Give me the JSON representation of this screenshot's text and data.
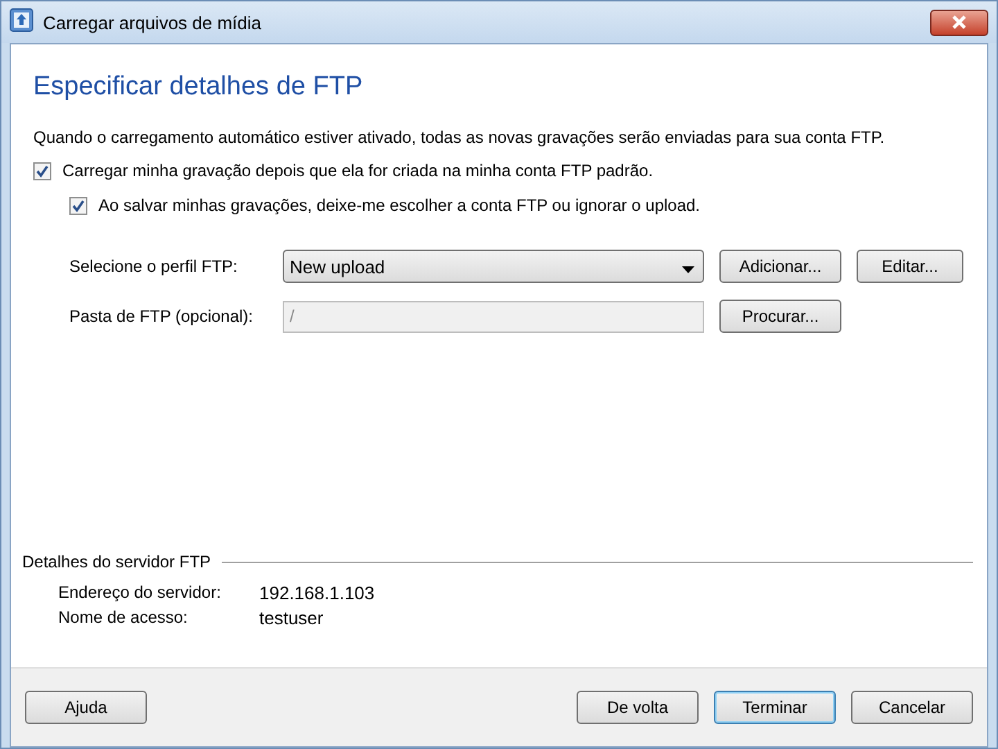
{
  "window": {
    "title": "Carregar arquivos de mídia"
  },
  "heading": "Especificar detalhes de FTP",
  "description": "Quando o carregamento automático estiver ativado, todas as novas gravações serão enviadas para sua conta FTP.",
  "options": [
    {
      "label": "Carregar minha gravação depois que ela for criada na minha conta FTP padrão.",
      "checked": true
    },
    {
      "label": "Ao salvar minhas gravações, deixe-me escolher a conta FTP ou ignorar o upload.",
      "checked": true
    }
  ],
  "profile": {
    "label": "Selecione o perfil FTP:",
    "value": "New upload",
    "buttons": [
      "Adicionar...",
      "Editar..."
    ]
  },
  "folder": {
    "label": "Pasta de FTP (opcional):",
    "value": "/",
    "disabled": true,
    "buttons": [
      "Procurar..."
    ]
  },
  "server": {
    "title": "Detalhes do servidor FTP",
    "rows": [
      {
        "label": "Endereço do servidor:",
        "value": "192.168.1.103"
      },
      {
        "label": "Nome de acesso:",
        "value": "testuser"
      }
    ]
  },
  "footer": {
    "left": [
      {
        "label": "Ajuda",
        "default": false
      }
    ],
    "right": [
      {
        "label": "De volta",
        "default": false
      },
      {
        "label": "Terminar",
        "default": true
      },
      {
        "label": "Cancelar",
        "default": false
      }
    ]
  }
}
